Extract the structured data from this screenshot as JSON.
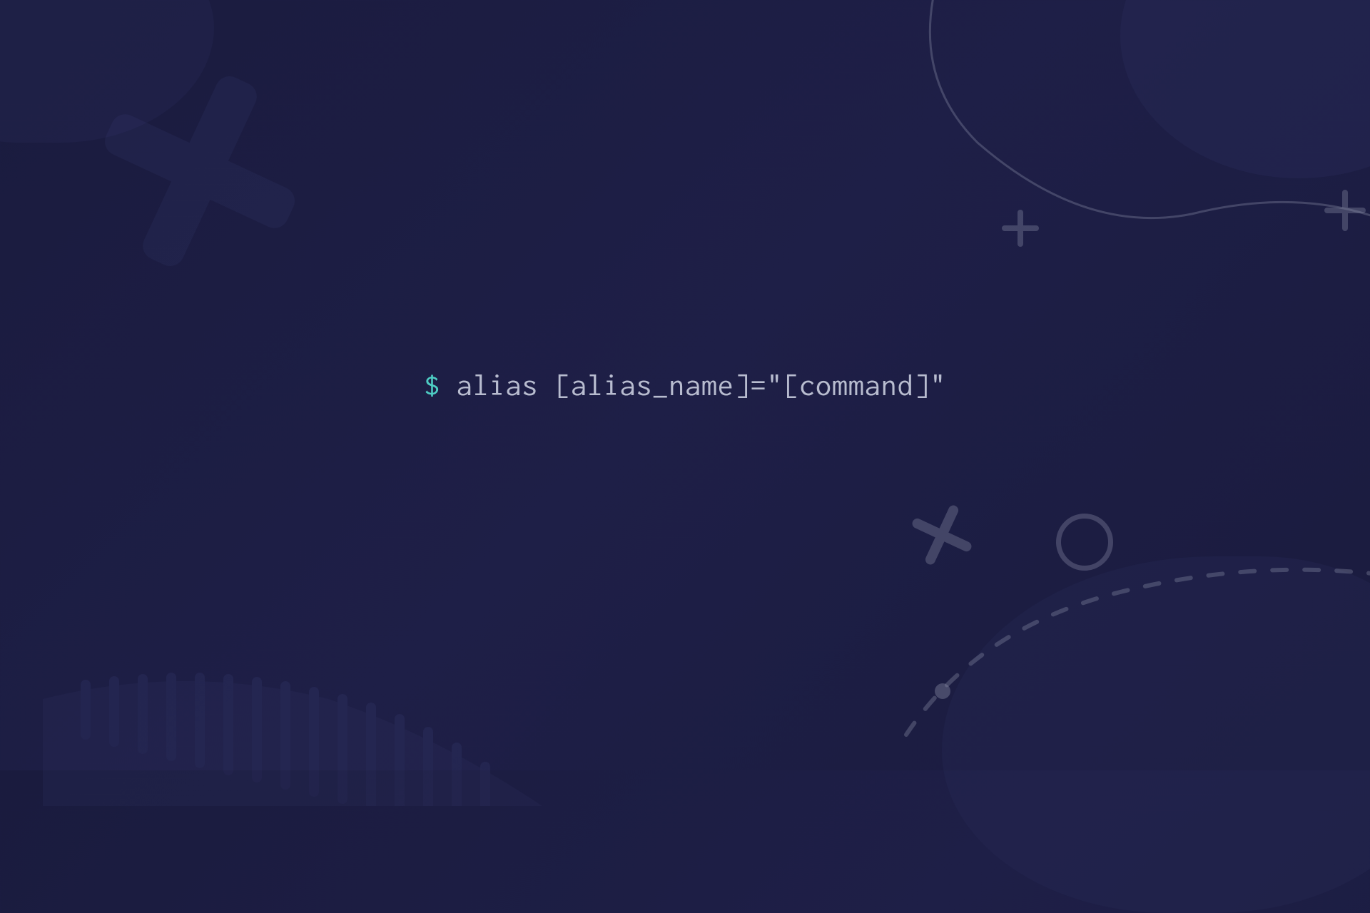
{
  "terminal": {
    "prompt": "$",
    "command": " alias [alias_name]=\"[command]\""
  },
  "colors": {
    "background": "#1a1b3e",
    "prompt": "#4ecdc4",
    "command_text": "#b8bccf",
    "decorative": "#8b8fa8"
  }
}
